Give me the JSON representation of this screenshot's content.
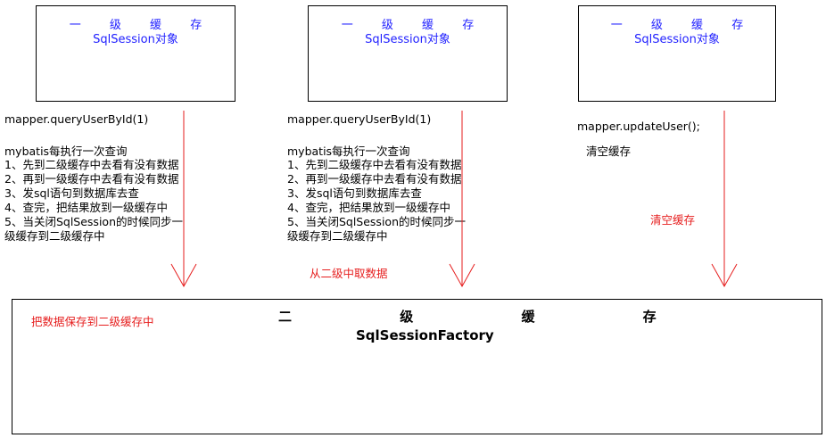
{
  "l1_boxes": [
    {
      "title": "一 级 缓 存",
      "subtitle": "SqlSession对象"
    },
    {
      "title": "一 级 缓 存",
      "subtitle": "SqlSession对象"
    },
    {
      "title": "一 级 缓 存",
      "subtitle": "SqlSession对象"
    }
  ],
  "col1": {
    "call": "mapper.queryUserById(1)",
    "heading": "mybatis每执行一次查询",
    "steps": [
      "1、先到二级缓存中去看有没有数据",
      "2、再到一级缓存中去看有没有数据",
      "3、发sql语句到数据库去查",
      "4、查完，把结果放到一级缓存中",
      "5、当关闭SqlSession的时候同步一",
      "级缓存到二级缓存中"
    ]
  },
  "col2": {
    "call": "mapper.queryUserById(1)",
    "heading": "mybatis每执行一次查询",
    "steps": [
      "1、先到二级缓存中去看有没有数据",
      "2、再到一级缓存中去看有没有数据",
      "3、发sql语句到数据库去查",
      "4、查完，把结果放到一级缓存中",
      "5、当关闭SqlSession的时候同步一",
      "级缓存到二级缓存中"
    ],
    "note": "从二级中取数据"
  },
  "col3": {
    "call": "mapper.updateUser();",
    "desc": "清空缓存",
    "note": "清空缓存"
  },
  "l2_box": {
    "title": "二 级 缓 存",
    "subtitle": "SqlSessionFactory",
    "note": "把数据保存到二级缓存中"
  },
  "colors": {
    "box_title": "#1f1fff",
    "arrow": "#e61e1e",
    "note": "#e61e1e"
  }
}
